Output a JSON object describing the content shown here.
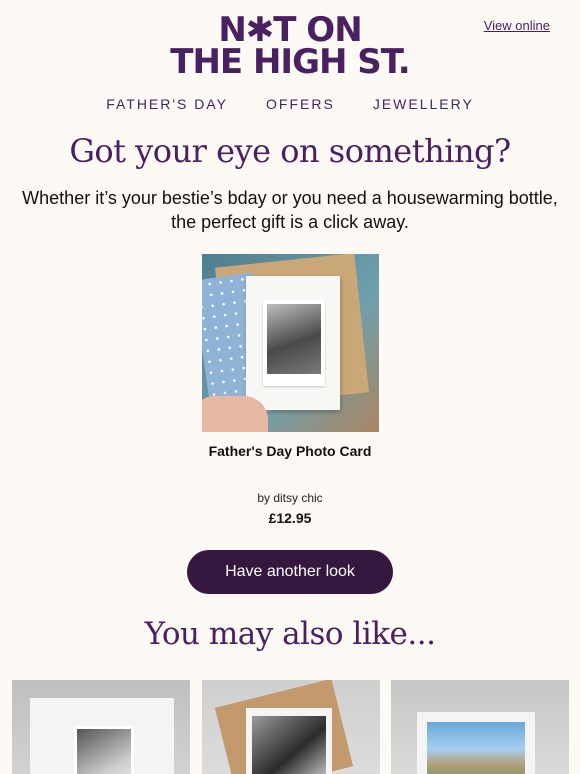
{
  "header": {
    "view_online": "View online",
    "logo_line1": "N✱T ON",
    "logo_line2": "THE HIGH ST."
  },
  "nav": {
    "items": [
      {
        "label": "FATHER'S DAY"
      },
      {
        "label": "OFFERS"
      },
      {
        "label": "JEWELLERY"
      }
    ]
  },
  "hero": {
    "headline": "Got your eye on something?",
    "subcopy_line1": "Whether it’s your bestie’s bday or you need a housewarming bottle,",
    "subcopy_line2": "the perfect gift is a click away."
  },
  "product": {
    "name": "Father's Day Photo Card",
    "seller": "by ditsy chic",
    "price": "£12.95"
  },
  "cta": {
    "label": "Have another look"
  },
  "recommendations": {
    "heading": "You may also like..."
  },
  "colors": {
    "brand_purple": "#4a2160",
    "button_dark": "#34163f",
    "background": "#fdf9f5"
  }
}
